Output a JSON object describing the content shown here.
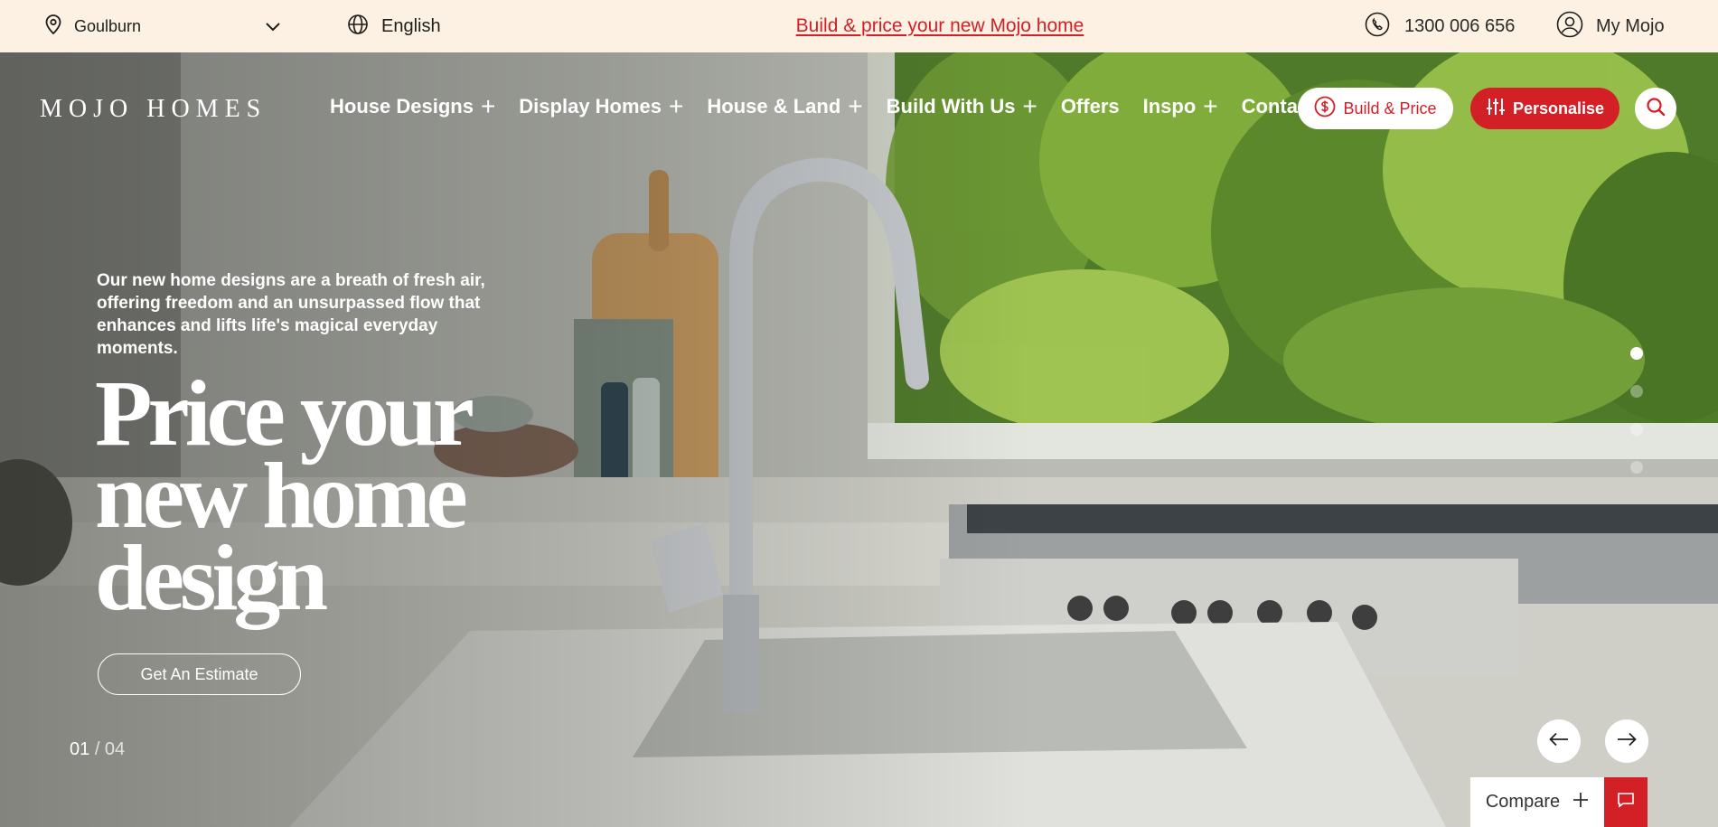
{
  "topbar": {
    "location": "Goulburn",
    "language": "English",
    "promo_link": "Build & price your new Mojo home",
    "phone": "1300 006 656",
    "account": "My Mojo"
  },
  "nav": {
    "logo": "MOJO HOMES",
    "items": [
      {
        "label": "House Designs",
        "expandable": true
      },
      {
        "label": "Display Homes",
        "expandable": true
      },
      {
        "label": "House & Land",
        "expandable": true
      },
      {
        "label": "Build With Us",
        "expandable": true
      },
      {
        "label": "Offers",
        "expandable": false
      },
      {
        "label": "Inspo",
        "expandable": true
      },
      {
        "label": "Contact",
        "expandable": false
      }
    ],
    "build_price_label": "Build & Price",
    "personalise_label": "Personalise"
  },
  "hero": {
    "intro": "Our new home designs are a breath of fresh air, offering freedom and an unsurpassed flow that enhances and lifts life's magical everyday moments.",
    "headline_lines": [
      "Price your",
      "new home",
      "design"
    ],
    "cta_label": "Get An Estimate",
    "slide_current": "01",
    "slide_total": "/ 04",
    "slide_index": 1,
    "slide_count": 4
  },
  "compare": {
    "label": "Compare"
  },
  "colors": {
    "brand_red": "#d31f26",
    "topbar_bg": "#fdf1e3",
    "white": "#ffffff"
  },
  "icons": {
    "location": "map-pin-icon",
    "chevron": "chevron-down-icon",
    "language": "globe-icon",
    "phone": "phone-icon",
    "account": "user-circle-icon",
    "build_price": "dollar-circle-icon",
    "personalise": "sliders-icon",
    "search": "search-icon",
    "prev": "arrow-left-icon",
    "next": "arrow-right-icon",
    "compare": "plus-icon",
    "chat": "chat-icon"
  }
}
